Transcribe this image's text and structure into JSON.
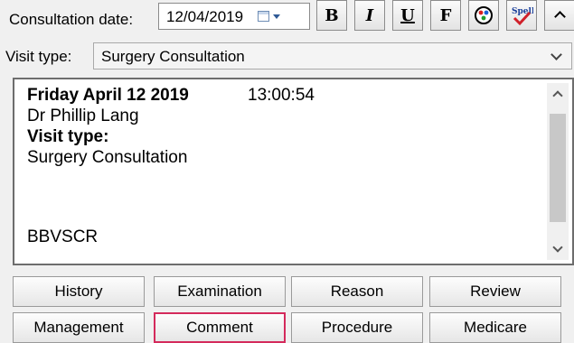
{
  "consultation": {
    "date_label": "Consultation date:",
    "date_value": "12/04/2019"
  },
  "toolbar": {
    "bold": "B",
    "italic": "I",
    "underline": "U",
    "font": "F",
    "spell": "Spell"
  },
  "visit": {
    "label": "Visit type:",
    "value": "Surgery Consultation"
  },
  "notes": {
    "date_line": "Friday April 12 2019",
    "time": "13:00:54",
    "doctor": "Dr Phillip Lang",
    "visit_type_heading": "Visit type:",
    "visit_type_value": "Surgery Consultation",
    "code": "BBVSCR"
  },
  "buttons": {
    "history": "History",
    "examination": "Examination",
    "reason": "Reason",
    "review": "Review",
    "management": "Management",
    "comment": "Comment",
    "procedure": "Procedure",
    "medicare": "Medicare"
  },
  "colors": {
    "active_border": "#d42a5c"
  }
}
